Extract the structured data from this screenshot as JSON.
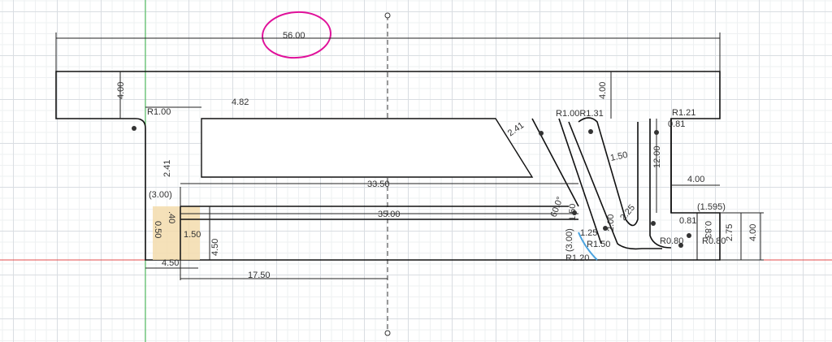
{
  "canvas": {
    "type": "sketch",
    "profile_fill": "#e6f0f8",
    "highlight_fill": "#f3d9a8",
    "annotation_color": "#e0119a",
    "x_axis_color": "#e34b4b",
    "y_axis_color": "#3cb84a"
  },
  "dims": {
    "overall_width": "56.00",
    "top_bar_height_left": "4.00",
    "top_bar_height_right": "4.00",
    "fillet_left": "R1.00",
    "pocket_offset": "4.82",
    "pocket_height": "2.41",
    "slant_width": "2.41",
    "pocket_length": "33.50",
    "slot_length": "35.00",
    "left_ref": "(3.00)",
    "left_base": "4.50",
    "left_height": "4.50",
    "center_offset": "17.50",
    "small_a": "0.50",
    "small_b": ".40",
    "small_c": "1.50",
    "rib_height": "12.00",
    "right_width": "4.00",
    "slot_width": "1.50",
    "fillet_right": "R1.21",
    "rib_thk": "0.81",
    "fillet_mid": "R1.00R1.31",
    "angle": "60.0°",
    "step_a": "1.50",
    "step_b": "1.25",
    "fillet_r150": "R1.50",
    "fillet_r120": "R1.20",
    "ref_300": "(3.00)",
    "slot_dia": "2.25",
    "slot_h": "2.00",
    "hook_w": "0.81",
    "fillet_r080a": "R0.80",
    "fillet_r080b": "R0.80",
    "tab_ref": "(1.595)",
    "tab_h": "2.75",
    "tab_total": "4.00",
    "tab_small": "0.83"
  }
}
